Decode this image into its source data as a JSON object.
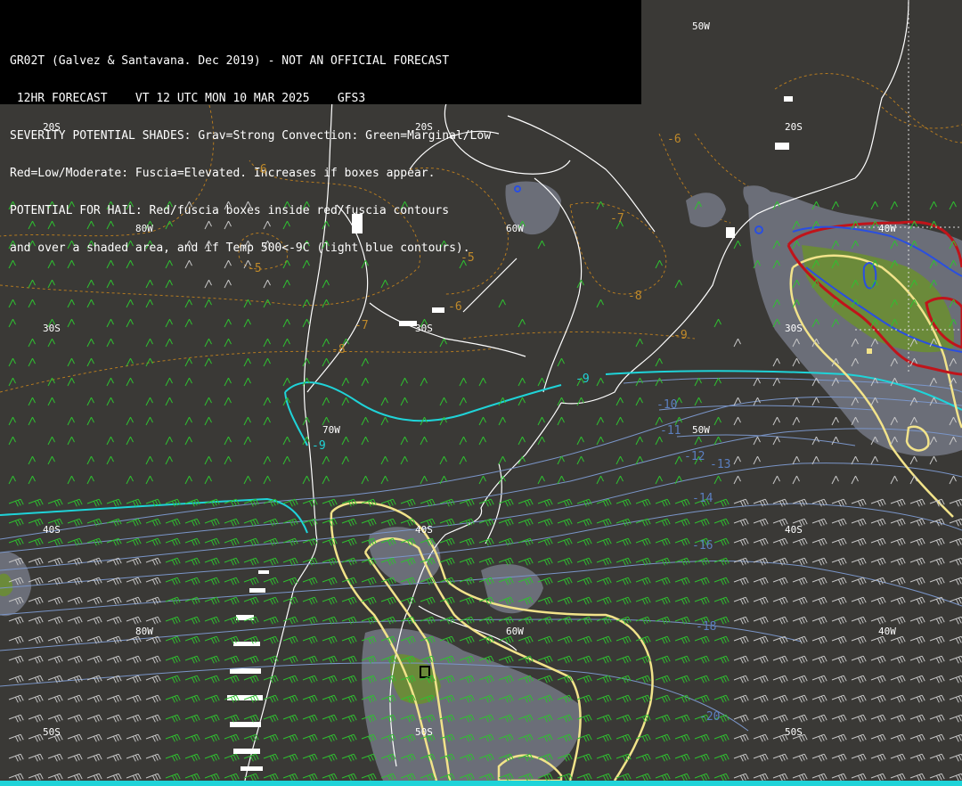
{
  "header": {
    "line1": "GR02T (Galvez & Santavana. Dec 2019) - NOT AN OFFICIAL FORECAST",
    "line2": " 12HR FORECAST    VT 12 UTC MON 10 MAR 2025    GFS3",
    "line3": "SEVERITY POTENTIAL SHADES: Grav=Strong Convection: Green=Marginal/Low",
    "line4": "Red=Low/Moderate: Fuscia=Elevated. Increases if boxes appear.",
    "line5": "POTENTIAL FOR HAIL: Red/fuscia boxes inside red/fuscia contours",
    "line6": "and over a shaded area, and if Temp 500<-9C (light blue contours)."
  },
  "grid_labels": {
    "lat20_a": "20S",
    "lat20_b": "20S",
    "lat20_c": "20S",
    "lat30_a": "30S",
    "lat30_b": "30S",
    "lat30_c": "30S",
    "lat40_a": "40S",
    "lat40_b": "40S",
    "lat40_c": "40S",
    "lat50_a": "50S",
    "lat50_b": "50S",
    "lat50_c": "50S",
    "lon80_a": "80W",
    "lon80_b": "80W",
    "lon60_a": "60W",
    "lon60_b": "60W",
    "lon50_a": "50W",
    "lon50_b": "50W",
    "lon40_a": "40W",
    "lon40_b": "40W",
    "lon70": "70W"
  },
  "temp_labels": {
    "t10": "-10",
    "t11": "-11",
    "t12": "-12",
    "t13": "-13",
    "t14": "-14",
    "t16": "-16",
    "t18": "-18",
    "t20": "-20",
    "t9a": "-9",
    "t9b": "-9"
  },
  "press_labels": {
    "p6a": "-6",
    "p6b": "-6",
    "p6c": "-6",
    "p5a": "-5",
    "p5b": "-5",
    "p7a": "-7",
    "p7b": "-7",
    "p8a": "-8",
    "p8b": "-8",
    "p9": "-9"
  },
  "colors": {
    "background": "#3a3936",
    "coast": "#ffffff",
    "temp_contour": "#7a95c8",
    "freeze_contour": "#1fd3d8",
    "severity_yellow": "#f2e38a",
    "hail_red": "#c0141a",
    "hail_blue": "#2a4fe0",
    "shade_gray": "#6b6e78",
    "shade_green": "#6b8a3a",
    "wind_green": "#2fc030",
    "wind_gray": "#c8c8c8",
    "press_orange": "#c08a2a"
  }
}
